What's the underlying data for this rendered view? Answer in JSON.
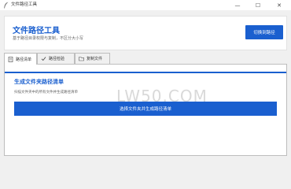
{
  "window": {
    "title": "文件路径工具",
    "minimize_glyph": "—",
    "maximize_glyph": "☐",
    "close_glyph": "✕"
  },
  "header": {
    "title": "文件路径工具",
    "subtitle": "基于路径目录权限与复制，不区分大小写",
    "switch_button": "切换到路径"
  },
  "tabs": [
    {
      "label": "路径清单",
      "icon": "document-icon",
      "active": true
    },
    {
      "label": "路径检验",
      "icon": "checkmark-icon",
      "active": false
    },
    {
      "label": "复制文件",
      "icon": "folder-icon",
      "active": false
    }
  ],
  "panel": {
    "section_title": "生成文件夹路径清单",
    "section_desc": "扫描文件夹中的所有文件并生成路径清单",
    "primary_button": "选择文件夹并生成路径清单"
  },
  "watermark": "LW50.COM",
  "colors": {
    "accent": "#1a5fcf",
    "background": "#f0f0f0",
    "panel": "#ffffff"
  }
}
